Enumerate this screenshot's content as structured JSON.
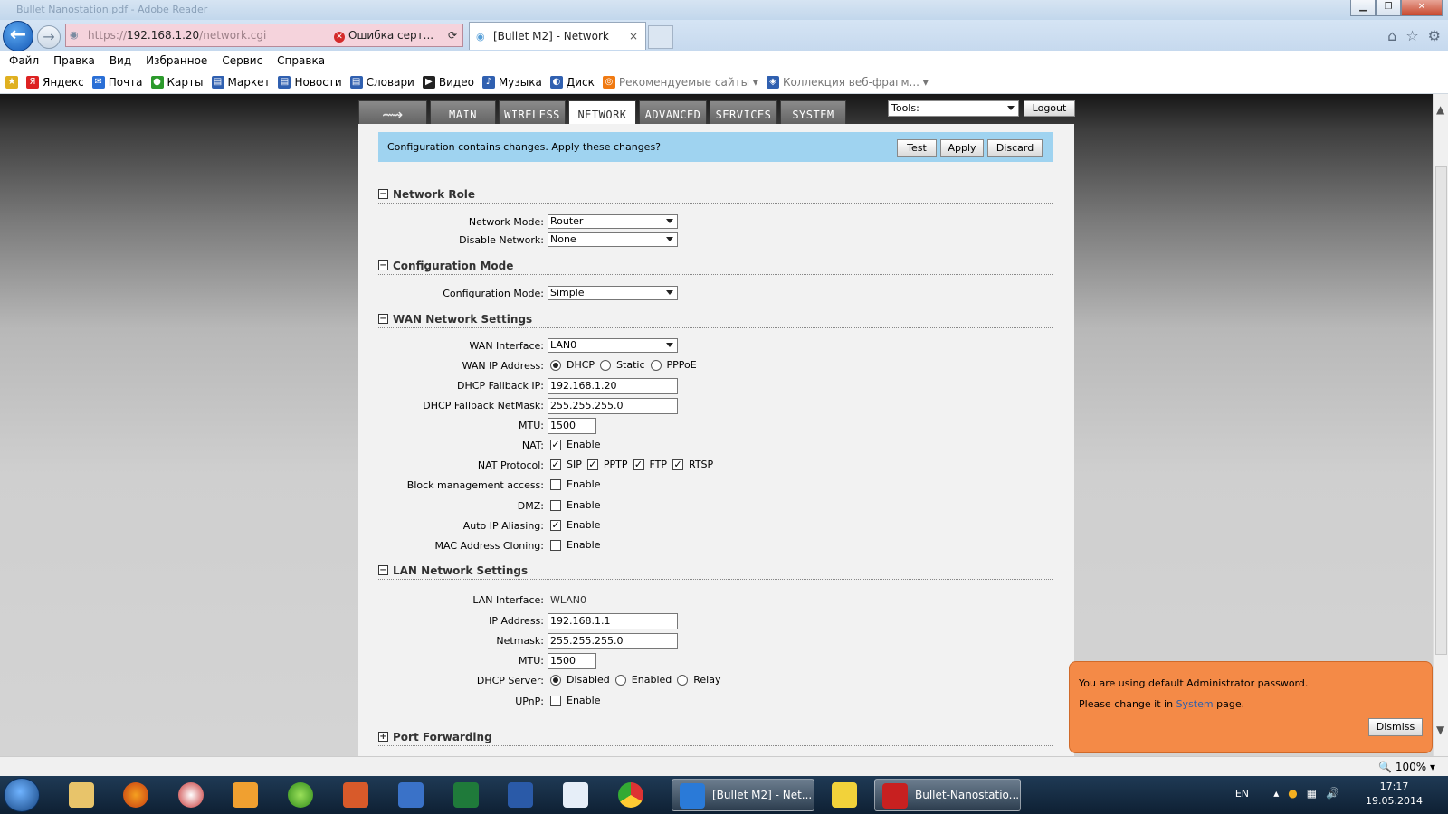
{
  "browser": {
    "window_title": "Bullet Nanostation.pdf - Adobe Reader",
    "address": {
      "scheme": "https://",
      "host": "192.168.1.20",
      "path": "/network.cgi",
      "cert_error": "Ошибка серт..."
    },
    "tab": {
      "title": "[Bullet M2] - Network",
      "close": "×"
    },
    "menu": [
      "Файл",
      "Правка",
      "Вид",
      "Избранное",
      "Сервис",
      "Справка"
    ],
    "favorites": [
      {
        "label": "Яндекс",
        "color": "#d22"
      },
      {
        "label": "Почта",
        "color": "#2a6fd6"
      },
      {
        "label": "Карты",
        "color": "#2c9a2c"
      },
      {
        "label": "Маркет",
        "color": "#3060b0"
      },
      {
        "label": "Новости",
        "color": "#3060b0"
      },
      {
        "label": "Словари",
        "color": "#3060b0"
      },
      {
        "label": "Видео",
        "color": "#222"
      },
      {
        "label": "Музыка",
        "color": "#3060b0"
      },
      {
        "label": "Диск",
        "color": "#3060b0"
      },
      {
        "label": "Рекомендуемые сайты ▾",
        "color": "#f07a12"
      },
      {
        "label": "Коллекция веб-фрагм... ▾",
        "color": "#3060b0"
      }
    ]
  },
  "ubnt": {
    "tabs": [
      "MAIN",
      "WIRELESS",
      "NETWORK",
      "ADVANCED",
      "SERVICES",
      "SYSTEM"
    ],
    "active_tab": "NETWORK",
    "tools_label": "Tools:",
    "logout_label": "Logout",
    "changes_text": "Configuration contains changes. Apply these changes?",
    "test_label": "Test",
    "apply_label": "Apply",
    "discard_label": "Discard",
    "sections": {
      "network_role": "Network Role",
      "configuration_mode": "Configuration Mode",
      "wan": "WAN Network Settings",
      "lan": "LAN Network Settings",
      "port_forwarding": "Port Forwarding"
    },
    "fields": {
      "network_mode": {
        "label": "Network Mode:",
        "value": "Router"
      },
      "disable_network": {
        "label": "Disable Network:",
        "value": "None"
      },
      "config_mode": {
        "label": "Configuration Mode:",
        "value": "Simple"
      },
      "wan_interface": {
        "label": "WAN Interface:",
        "value": "LAN0"
      },
      "wan_ip": {
        "label": "WAN IP Address:",
        "options": [
          "DHCP",
          "Static",
          "PPPoE"
        ]
      },
      "dhcp_fallback_ip": {
        "label": "DHCP Fallback IP:",
        "value": "192.168.1.20"
      },
      "dhcp_fallback_netmask": {
        "label": "DHCP Fallback NetMask:",
        "value": "255.255.255.0"
      },
      "wan_mtu": {
        "label": "MTU:",
        "value": "1500"
      },
      "nat": {
        "label": "NAT:",
        "option": "Enable"
      },
      "nat_protocol": {
        "label": "NAT Protocol:",
        "options": [
          "SIP",
          "PPTP",
          "FTP",
          "RTSP"
        ]
      },
      "block_mgmt": {
        "label": "Block management access:",
        "option": "Enable"
      },
      "dmz": {
        "label": "DMZ:",
        "option": "Enable"
      },
      "auto_ip": {
        "label": "Auto IP Aliasing:",
        "option": "Enable"
      },
      "mac_cloning": {
        "label": "MAC Address Cloning:",
        "option": "Enable"
      },
      "lan_interface": {
        "label": "LAN Interface:",
        "value": "WLAN0"
      },
      "lan_ip": {
        "label": "IP Address:",
        "value": "192.168.1.1"
      },
      "lan_netmask": {
        "label": "Netmask:",
        "value": "255.255.255.0"
      },
      "lan_mtu": {
        "label": "MTU:",
        "value": "1500"
      },
      "dhcp_server": {
        "label": "DHCP Server:",
        "options": [
          "Disabled",
          "Enabled",
          "Relay"
        ]
      },
      "upnp": {
        "label": "UPnP:",
        "option": "Enable"
      }
    },
    "notice": {
      "line1": "You are using default Administrator password.",
      "line2_pre": "Please change it in",
      "line2_link": "System",
      "line2_post": "page.",
      "dismiss": "Dismiss"
    }
  },
  "statusbar": {
    "zoom": "100%"
  },
  "taskbar": {
    "ie_window": "[Bullet M2] - Net...",
    "pdf_window": "Bullet-Nanostatio...",
    "lang": "EN",
    "time": "17:17",
    "date": "19.05.2014"
  }
}
